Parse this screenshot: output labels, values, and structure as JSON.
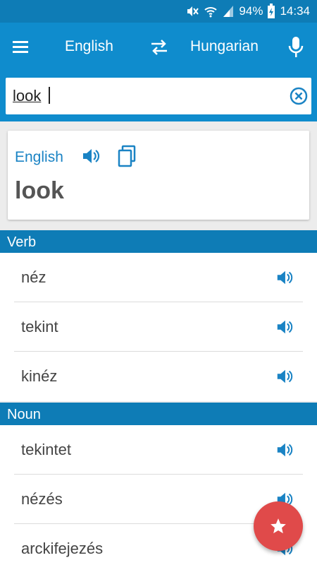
{
  "status": {
    "battery": "94%",
    "time": "14:34"
  },
  "appbar": {
    "source_language": "English",
    "target_language": "Hungarian"
  },
  "search": {
    "value": "look"
  },
  "card": {
    "language": "English",
    "word": "look"
  },
  "sections": [
    {
      "label": "Verb",
      "items": [
        "néz",
        "tekint",
        "kinéz"
      ]
    },
    {
      "label": "Noun",
      "items": [
        "tekintet",
        "nézés",
        "arckifejezés"
      ]
    }
  ],
  "colors": {
    "primary": "#0f8ccd",
    "primary_dark": "#0e7cb6",
    "accent": "#e04a4a",
    "link": "#1a83c4"
  }
}
